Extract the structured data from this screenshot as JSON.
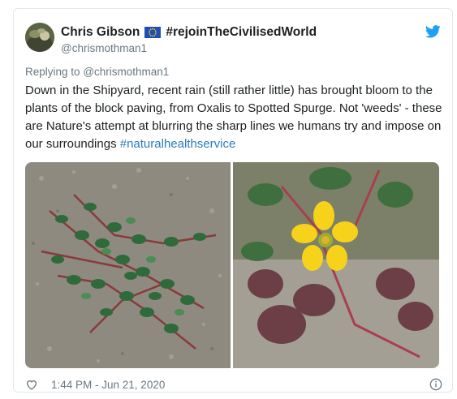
{
  "tweet": {
    "author": {
      "display_name": "Chris Gibson",
      "name_hashtag": "#rejoinTheCivilisedWorld",
      "handle": "@chrismothman1",
      "avatar_icon": "avatar-photo",
      "flag_icon": "eu-flag-icon"
    },
    "reply_prefix": "Replying to",
    "reply_to": "@chrismothman1",
    "text": "Down in the Shipyard, recent rain (still rather little) has brought bloom to the plants of the block paving, from Oxalis to Spotted Spurge. Not 'weeds' - these are Nature's attempt at blurring the sharp lines we humans try and impose on our surroundings ",
    "hashtag_link": "#naturalhealthservice",
    "timestamp": "1:44 PM - Jun 21, 2020",
    "colors": {
      "link": "#2b7bb9",
      "muted": "#697882",
      "brand": "#1da1f2"
    }
  }
}
